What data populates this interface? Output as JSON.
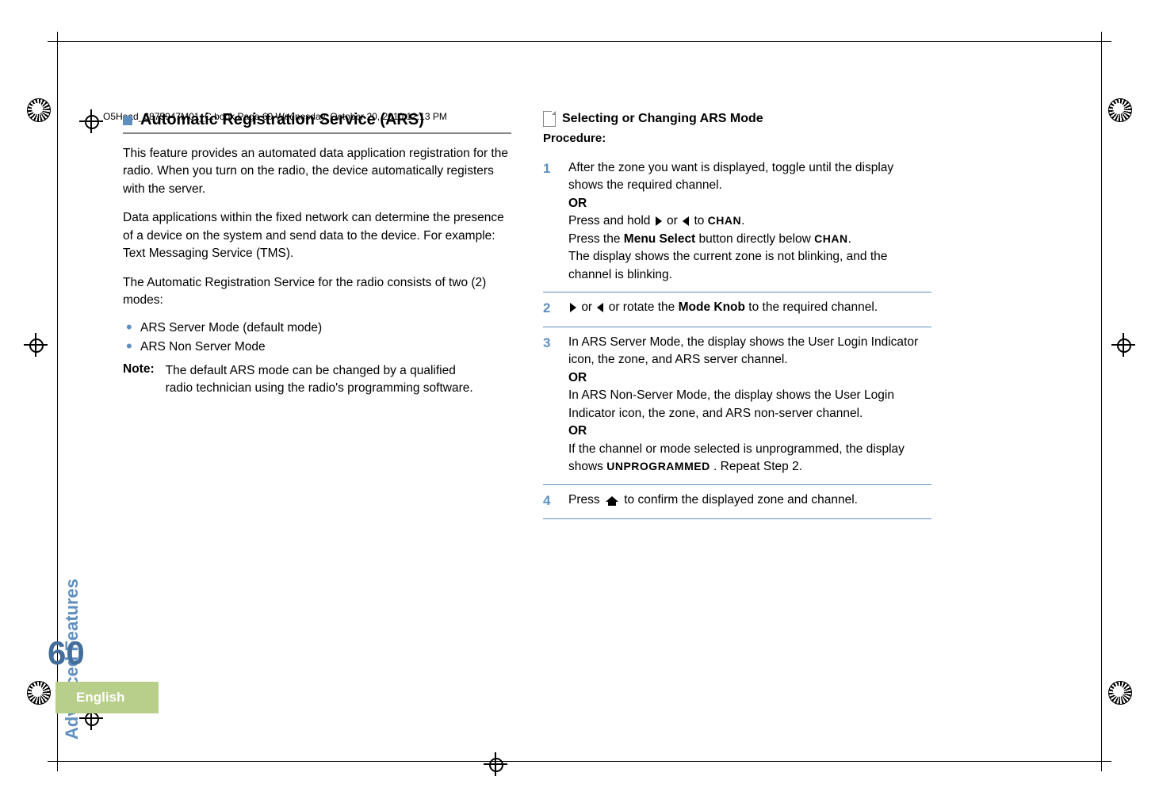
{
  "running_header": "O5Head_6875947M01_C.book  Page 60  Wednesday, October 20, 2010  12:13 PM",
  "sidebar": {
    "section_label": "Advanced Features",
    "page_number": "60",
    "language": "English"
  },
  "left": {
    "section_title": "Automatic Registration Service (ARS)",
    "para1": "This feature provides an automated data application registration for the radio. When you turn on the radio, the device automatically registers with the server.",
    "para2": "Data applications within the fixed network can determine the presence of a device on the system and send data to the device. For example: Text Messaging Service (TMS).",
    "para3": "The Automatic Registration Service for the radio consists of two (2) modes:",
    "bullet1": "ARS Server Mode (default mode)",
    "bullet2": "ARS Non Server Mode",
    "note_label": "Note:",
    "note_body": "The default ARS mode can be changed by a qualified radio technician using the radio's programming software."
  },
  "right": {
    "sub_title": "Selecting or Changing ARS Mode",
    "procedure_label": "Procedure:",
    "step1": {
      "num": "1",
      "line1": "After the zone you want is displayed, toggle until the display shows the required channel.",
      "or1": "OR",
      "line2a": "Press and hold ",
      "line2b": " or ",
      "line2c": " to ",
      "chan": "CHAN",
      "period": ".",
      "line3a": "Press the ",
      "menu_select": "Menu Select",
      "line3b": " button directly below ",
      "line4": "The display shows the current zone is not blinking, and the channel is blinking."
    },
    "step2": {
      "num": "2",
      "text_a": " or ",
      "text_b": " or rotate the ",
      "mode_knob": "Mode Knob",
      "text_c": " to the required channel."
    },
    "step3": {
      "num": "3",
      "l1": "In ARS Server Mode, the display shows the User Login Indicator icon, the zone, and ARS server channel.",
      "or1": "OR",
      "l2": "In ARS Non-Server Mode, the display shows the User Login Indicator icon, the zone, and ARS non-server channel.",
      "or2": "OR",
      "l3a": "If the channel or mode selected is unprogrammed, the display shows ",
      "unprog": "UNPROGRAMMED",
      "l3b": ". Repeat Step 2."
    },
    "step4": {
      "num": "4",
      "text_a": "Press ",
      "text_b": " to confirm the displayed zone and channel."
    }
  }
}
